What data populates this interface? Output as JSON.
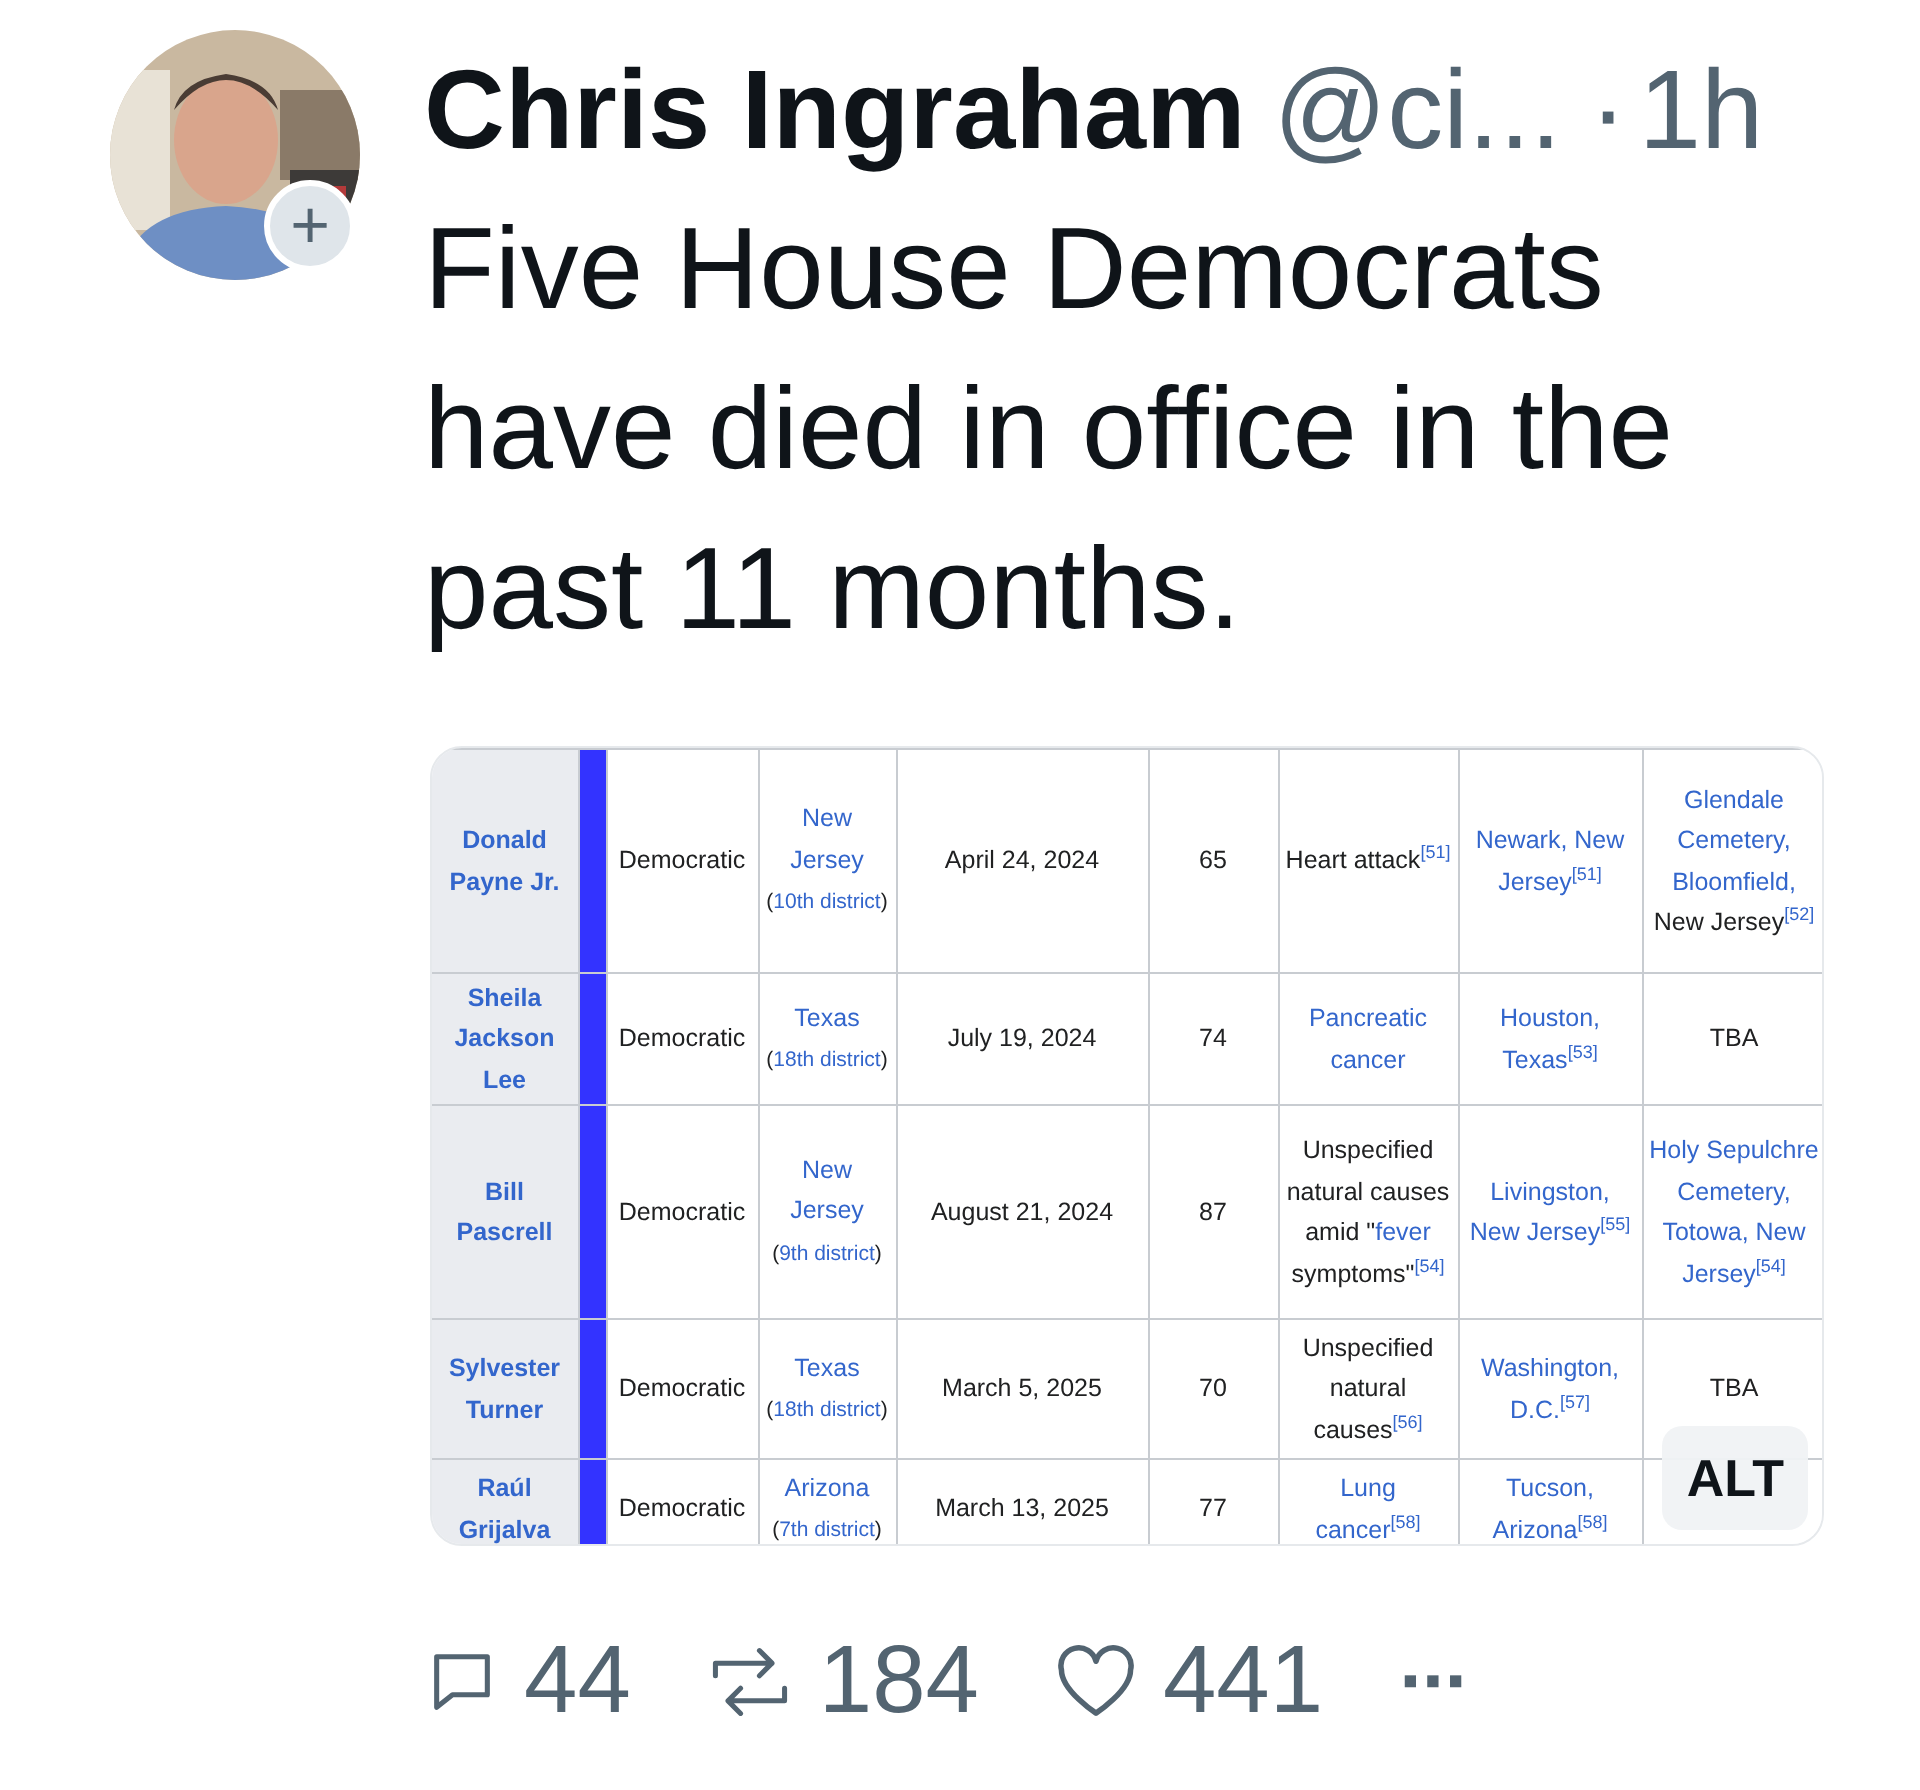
{
  "author": {
    "name": "Chris Ingraham",
    "handle": "@ci...",
    "separator": "·",
    "time": "1h",
    "follow_button": "+"
  },
  "text": "Five House Democrats have died in office in the past 11 months.",
  "image": {
    "alt_badge": "ALT",
    "rows": [
      {
        "name": "Donald Payne Jr.",
        "party": "Democratic",
        "district": [
          {
            "t": "New Jersey",
            "kind": "heading"
          },
          {
            "t": "(",
            "kind": "subtext"
          },
          {
            "t": "10th district",
            "kind": "sublink"
          },
          {
            "t": ")",
            "kind": "subtext"
          }
        ],
        "date": "April 24, 2024",
        "age": "65",
        "cause": [
          {
            "t": "Heart attack",
            "kind": "text"
          },
          {
            "t": "$^{[51]}$",
            "kind": "link"
          }
        ],
        "place": [
          {
            "t": "Newark, New Jersey$^{[51]}$",
            "kind": "link"
          }
        ],
        "burial": [
          {
            "t": "Glendale Cemetery, Bloomfield,",
            "kind": "link"
          },
          {
            "t": " New Jersey",
            "kind": "text"
          },
          {
            "t": "$^{[52]}$",
            "kind": "link"
          }
        ]
      },
      {
        "name": "Sheila Jackson Lee",
        "party": "Democratic",
        "district": [
          {
            "t": "Texas",
            "kind": "heading"
          },
          {
            "t": "(",
            "kind": "subtext"
          },
          {
            "t": "18th district",
            "kind": "sublink"
          },
          {
            "t": ")",
            "kind": "subtext"
          }
        ],
        "date": "July 19, 2024",
        "age": "74",
        "cause": [
          {
            "t": "Pancreatic cancer",
            "kind": "link"
          }
        ],
        "place": [
          {
            "t": "Houston, Texas$^{[53]}$",
            "kind": "link"
          }
        ],
        "burial": [
          {
            "t": "TBA",
            "kind": "text"
          }
        ]
      },
      {
        "name": "Bill Pascrell",
        "party": "Democratic",
        "district": [
          {
            "t": "New Jersey",
            "kind": "heading"
          },
          {
            "t": "(",
            "kind": "subtext"
          },
          {
            "t": "9th district",
            "kind": "sublink"
          },
          {
            "t": ")",
            "kind": "subtext"
          }
        ],
        "date": "August 21, 2024",
        "age": "87",
        "cause": [
          {
            "t": "Unspecified natural causes amid \"",
            "kind": "text"
          },
          {
            "t": "fever",
            "kind": "link"
          },
          {
            "t": " symptoms\"",
            "kind": "text"
          },
          {
            "t": "$^{[54]}$",
            "kind": "link"
          }
        ],
        "place": [
          {
            "t": "Livingston, New Jersey$^{[55]}$",
            "kind": "link"
          }
        ],
        "burial": [
          {
            "t": "Holy Sepulchre Cemetery, Totowa, New Jersey$^{[54]}$",
            "kind": "link"
          }
        ]
      },
      {
        "name": "Sylvester Turner",
        "party": "Democratic",
        "district": [
          {
            "t": "Texas",
            "kind": "heading"
          },
          {
            "t": "(",
            "kind": "subtext"
          },
          {
            "t": "18th district",
            "kind": "sublink"
          },
          {
            "t": ")",
            "kind": "subtext"
          }
        ],
        "date": "March 5, 2025",
        "age": "70",
        "cause": [
          {
            "t": "Unspecified natural causes",
            "kind": "text"
          },
          {
            "t": "$^{[56]}$",
            "kind": "link"
          }
        ],
        "place": [
          {
            "t": "Washington, D.C.$^{[57]}$",
            "kind": "link"
          }
        ],
        "burial": [
          {
            "t": "TBA",
            "kind": "text"
          }
        ]
      },
      {
        "name": "Raúl Grijalva",
        "party": "Democratic",
        "district": [
          {
            "t": "Arizona",
            "kind": "heading"
          },
          {
            "t": "(",
            "kind": "subtext"
          },
          {
            "t": "7th district",
            "kind": "sublink"
          },
          {
            "t": ")",
            "kind": "subtext"
          }
        ],
        "date": "March 13, 2025",
        "age": "77",
        "cause": [
          {
            "t": "Lung cancer$^{[58]}$",
            "kind": "link"
          }
        ],
        "place": [
          {
            "t": "Tucson, Arizona$^{[58]}$",
            "kind": "link"
          }
        ],
        "burial": []
      }
    ]
  },
  "actions": [
    {
      "kind": "reply",
      "label": "44"
    },
    {
      "kind": "repost",
      "label": "184"
    },
    {
      "kind": "like",
      "label": "441"
    },
    {
      "kind": "more",
      "label": "···"
    }
  ]
}
